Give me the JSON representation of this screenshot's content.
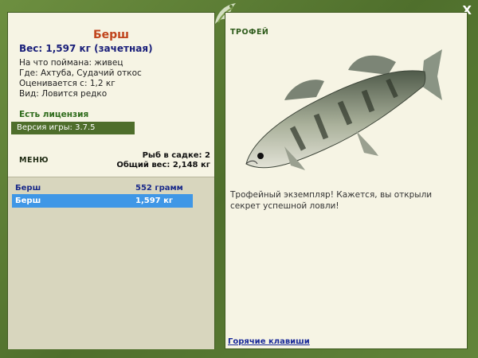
{
  "window": {
    "close_label": "X"
  },
  "fish": {
    "name": "Берш",
    "weight": "Вес: 1,597 кг (зачетная)",
    "bait": "На что поймана: живец",
    "place": "Где: Ахтуба, Судачий откос",
    "rated": "Оценивается с: 1,2 кг",
    "kind": "Вид: Ловится редко"
  },
  "license": "Есть лицензия",
  "version": "Версия игры: 3.7.5",
  "menu_label": "МЕНЮ",
  "stats": {
    "count": "Рыб в садке: 2",
    "total": "Общий вес: 2,148 кг"
  },
  "catch_list": [
    {
      "name": "Берш",
      "weight": "552 грамм"
    },
    {
      "name": "Берш",
      "weight": "1,597 кг"
    }
  ],
  "trophy": {
    "title": "ТРОФЕЙ",
    "text": "Трофейный экземпляр! Кажется, вы открыли секрет успешной ловли!"
  },
  "hotkeys": "Горячие клавиши",
  "colors": {
    "frame": "#5a7a34",
    "panel": "#f6f4e4",
    "name": "#c0441c",
    "selected": "#3f97e6"
  },
  "icons": [
    "close-icon",
    "fish-emblem-icon",
    "fish-image"
  ]
}
